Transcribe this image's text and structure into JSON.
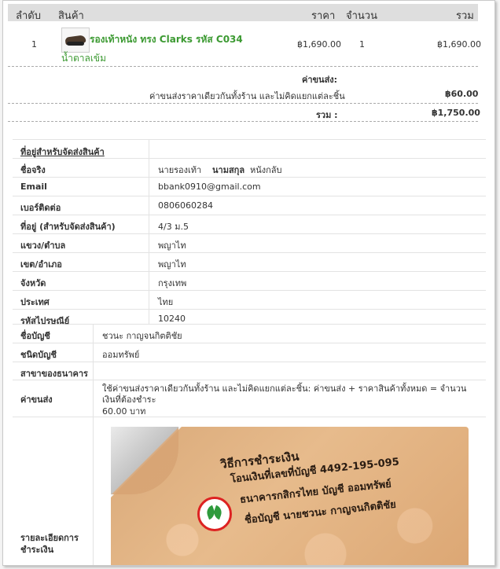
{
  "order_table": {
    "headers": {
      "index": "ลำดับ",
      "product": "สินค้า",
      "price": "ราคา",
      "qty": "จำนวน",
      "total": "รวม"
    },
    "items": [
      {
        "index": "1",
        "name": "รองเท้าหนัง ทรง Clarks รหัส C034",
        "variant": "น้ำตาลเข้ม",
        "price": "฿1,690.00",
        "qty": "1",
        "total": "฿1,690.00",
        "thumb_icon": "shoe-thumbnail"
      }
    ],
    "shipping_label": "ค่าขนส่ง:",
    "shipping_note": "ค่าขนส่งราคาเดียวกันทั้งร้าน และไม่คิดแยกแต่ละชิ้น",
    "shipping_value": "฿60.00",
    "sum_label": "รวม :",
    "sum_value": "฿1,750.00"
  },
  "address": {
    "section_title": "ที่อยู่สำหรับจัดส่งสินค้า",
    "rows": [
      {
        "label": "ชื่อจริง",
        "value": "นายรองเท้า",
        "value2_label": "นามสกุล",
        "value2": "หนังกลับ"
      },
      {
        "label": "Email",
        "value": "bbank0910@gmail.com"
      },
      {
        "label": "เบอร์ติดต่อ",
        "value": "0806060284"
      },
      {
        "label": "ที่อยู่ (สำหรับจัดส่งสินค้า)",
        "value": "4/3 ม.5"
      },
      {
        "label": "แขวง/ตำบล",
        "value": "พญาไท"
      },
      {
        "label": "เขต/อำเภอ",
        "value": "พญาไท"
      },
      {
        "label": "จังหวัด",
        "value": "กรุงเทพ"
      },
      {
        "label": "ประเทศ",
        "value": "ไทย"
      },
      {
        "label": "รหัสไปรษณีย์",
        "value": "10240"
      }
    ]
  },
  "bank": {
    "rows": [
      {
        "label": "ชื่อบัญชี",
        "value": "ชวนะ กาญจนกิตติชัย"
      },
      {
        "label": "ชนิดบัญชี",
        "value": "ออมทรัพย์"
      },
      {
        "label": "สาขาของธนาคาร",
        "value": ""
      }
    ],
    "shipping_label": "ค่าขนส่ง",
    "shipping_desc": "ใช้ค่าขนส่งราคาเดียวกันทั้งร้าน และไม่คิดแยกแต่ละชิ้น: ค่าขนส่ง + ราคาสินค้าทั้งหมด = จำนวนเงินที่ต้องชำระ",
    "shipping_amount": "60.00 บาท",
    "payment_label_line1": "รายละเอียดการ",
    "payment_label_line2": "ชำระเงิน",
    "payment_image": {
      "line1": "วิธีการชำระเงิน",
      "line2": "โอนเงินที่เลขที่บัญชี  4492-195-095",
      "line3": "ธนาคารกสิกรไทย บัญชี ออมทรัพย์",
      "line4": "ชื่อบัญชี นายชวนะ  กาญจนกิตติชัย",
      "logo_icon": "kasikorn-bank-logo-icon"
    }
  }
}
